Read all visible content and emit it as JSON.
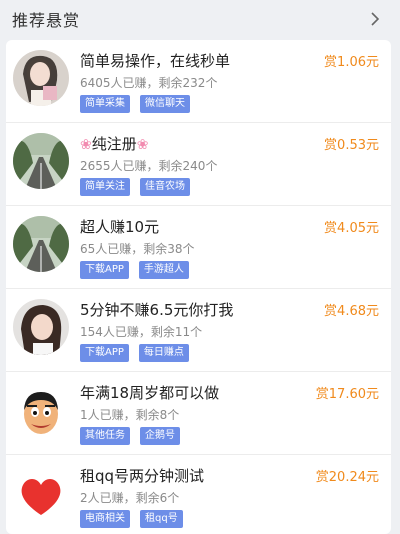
{
  "section": {
    "title": "推荐悬赏",
    "more_icon": "chevron-right-icon"
  },
  "tasks": [
    {
      "title": "简单易操作，在线秒单",
      "stats": "6405人已赚，剩余232个",
      "tags": [
        "简单采集",
        "微信聊天"
      ],
      "reward": "赏1.06元",
      "avatar": "woman-photo-avatar"
    },
    {
      "title": "纯注册",
      "stats": "2655人已赚，剩余240个",
      "tags": [
        "简单关注",
        "佳音农场"
      ],
      "reward": "赏0.53元",
      "avatar": "road-landscape-avatar",
      "title_icon": "flower-icon"
    },
    {
      "title": "超人赚10元",
      "stats": "65人已赚，剩余38个",
      "tags": [
        "下载APP",
        "手游超人"
      ],
      "reward": "赏4.05元",
      "avatar": "road-landscape-avatar"
    },
    {
      "title": "5分钟不赚6.5元你打我",
      "stats": "154人已赚，剩余11个",
      "tags": [
        "下载APP",
        "每日赚点"
      ],
      "reward": "赏4.68元",
      "avatar": "woman-photo-avatar"
    },
    {
      "title": "年满18周岁都可以做",
      "stats": "1人已赚，剩余8个",
      "tags": [
        "其他任务",
        "企鹅号"
      ],
      "reward": "赏17.60元",
      "avatar": "cartoon-face-avatar"
    },
    {
      "title": "租qq号两分钟测试",
      "stats": "2人已赚，剩余6个",
      "tags": [
        "电商相关",
        "租qq号"
      ],
      "reward": "赏20.24元",
      "avatar": "red-heart-avatar"
    }
  ],
  "colors": {
    "reward": "#f08a1c",
    "tag": "#6d8ee8",
    "background": "#eef0f3"
  }
}
